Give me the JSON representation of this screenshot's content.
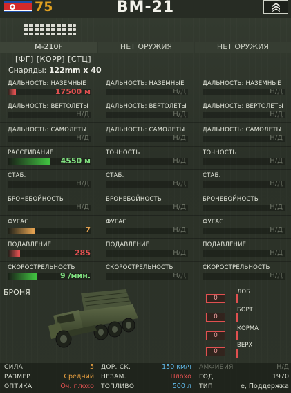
{
  "header": {
    "battle_rating": "75",
    "vehicle_name": "BM-21",
    "rank_icon": "chevron-rank-icon",
    "flag_icon": "nation-flag-icon"
  },
  "weapons": {
    "slot1": "M-210F",
    "slot2": "НЕТ ОРУЖИЯ",
    "slot3": "НЕТ ОРУЖИЯ",
    "ammo_types": "[ФГ] [КОРР] [СТЦ]",
    "shells_label": "Снаряды:",
    "shells_value": "122mm x 40"
  },
  "stats": [
    {
      "label": "ДАЛЬНОСТЬ: НАЗЕМНЫЕ",
      "col1": {
        "value": "17500 м",
        "fill": 0.1,
        "color": "#e05050",
        "valColor": "#e05050"
      },
      "col2": "ДАЛЬНОСТЬ: НАЗЕМНЫЕ",
      "col3": "ДАЛЬНОСТЬ: НАЗЕМНЫЕ",
      "na": "Н/Д"
    },
    {
      "label": "ДАЛЬНОСТЬ: ВЕРТОЛЕТЫ",
      "col1": null,
      "col2": "ДАЛЬНОСТЬ: ВЕРТОЛЕТЫ",
      "col3": "ДАЛЬНОСТЬ: ВЕРТОЛЕТЫ",
      "na": "Н/Д"
    },
    {
      "label": "ДАЛЬНОСТЬ: САМОЛЕТЫ",
      "col1": null,
      "col2": "ДАЛЬНОСТЬ: САМОЛЕТЫ",
      "col3": "ДАЛЬНОСТЬ: САМОЛЕТЫ",
      "na": "Н/Д"
    },
    {
      "label": "РАССЕИВАНИЕ",
      "col1": {
        "value": "4550 м",
        "fill": 0.5,
        "color": "#40c040",
        "valColor": "#80e080"
      },
      "col2": "ТОЧНОСТЬ",
      "col3": "ТОЧНОСТЬ",
      "na": "Н/Д"
    },
    {
      "label": "СТАБ.",
      "col1": null,
      "col2": "СТАБ.",
      "col3": "СТАБ.",
      "na": "Н/Д"
    },
    {
      "label": "БРОНЕБОЙНОСТЬ",
      "col1": null,
      "col2": "БРОНЕБОЙНОСТЬ",
      "col3": "БРОНЕБОЙНОСТЬ",
      "na": "Н/Д"
    },
    {
      "label": "ФУГАС",
      "col1": {
        "value": "7",
        "fill": 0.32,
        "color": "#e0a050",
        "valColor": "#e0a050"
      },
      "col2": "ФУГАС",
      "col3": "ФУГАС",
      "na": "Н/Д"
    },
    {
      "label": "ПОДАВЛЕНИЕ",
      "col1": {
        "value": "285",
        "fill": 0.15,
        "color": "#e05050",
        "valColor": "#e05050"
      },
      "col2": "ПОДАВЛЕНИЕ",
      "col3": "ПОДАВЛЕНИЕ",
      "na": "Н/Д"
    },
    {
      "label": "СКОРОСТРЕЛЬНОСТЬ",
      "col1": {
        "value": "9 /мин.",
        "fill": 0.35,
        "color": "#40c040",
        "valColor": "#80e080"
      },
      "col2": "СКОРОСТРЕЛЬНОСТЬ",
      "col3": "СКОРОСТРЕЛЬНОСТЬ",
      "na": "Н/Д"
    }
  ],
  "armor": {
    "title": "БРОНЯ",
    "front_label": "ЛОБ",
    "side_label": "БОРТ",
    "rear_label": "КОРМА",
    "top_label": "ВЕРХ",
    "front_value": "0",
    "side_value": "0",
    "rear_value": "0",
    "top_value": "0"
  },
  "info": {
    "power_label": "СИЛА",
    "power_value": "5",
    "size_label": "РАЗМЕР",
    "size_value": "Средний",
    "optics_label": "ОПТИКА",
    "optics_value": "Оч. плохо",
    "road_speed_label": "ДОР. СК.",
    "road_speed_value": "150 км/ч",
    "stealth_label": "НЕЗАМ.",
    "stealth_value": "Плохо",
    "fuel_label": "ТОПЛИВО",
    "fuel_value": "500 л",
    "amphib_label": "АМФИБИЯ",
    "amphib_value": "Н/Д",
    "year_label": "ГОД",
    "year_value": "1970",
    "type_label": "ТИП",
    "type_value": "е, Поддержка"
  },
  "colors": {
    "good": "#80e080",
    "bad": "#e05050",
    "medium": "#e0a050",
    "info_blue": "#60b8e8",
    "info_orange": "#e8a040"
  }
}
